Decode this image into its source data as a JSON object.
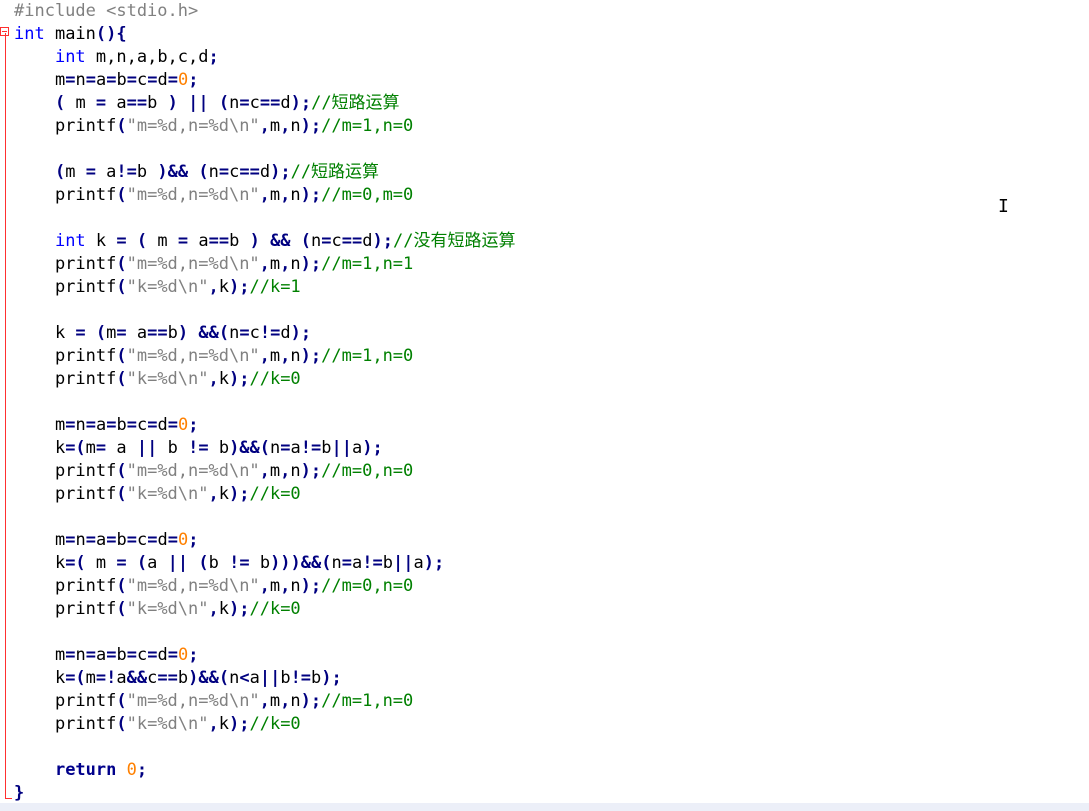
{
  "editor": {
    "language": "c",
    "colors": {
      "preprocessor": "#808080",
      "type_keyword": "#0000ff",
      "instruction_keyword": "#00008b",
      "operator": "#000080",
      "number": "#ff8000",
      "string": "#808080",
      "comment": "#008000",
      "fold_marker": "#ff3030"
    },
    "cursor_icon": "text-ibeam-cursor",
    "lines": [
      [
        {
          "t": "pp",
          "v": "#include <stdio.h>"
        }
      ],
      [
        {
          "t": "kw",
          "v": "int"
        },
        {
          "t": "id",
          "v": " main"
        },
        {
          "t": "op",
          "v": "(){"
        }
      ],
      [
        {
          "t": "id",
          "v": "    "
        },
        {
          "t": "kw",
          "v": "int"
        },
        {
          "t": "id",
          "v": " m,n,a,b,c,d"
        },
        {
          "t": "op",
          "v": ";"
        }
      ],
      [
        {
          "t": "id",
          "v": "    m"
        },
        {
          "t": "op",
          "v": "="
        },
        {
          "t": "id",
          "v": "n"
        },
        {
          "t": "op",
          "v": "="
        },
        {
          "t": "id",
          "v": "a"
        },
        {
          "t": "op",
          "v": "="
        },
        {
          "t": "id",
          "v": "b"
        },
        {
          "t": "op",
          "v": "="
        },
        {
          "t": "id",
          "v": "c"
        },
        {
          "t": "op",
          "v": "="
        },
        {
          "t": "id",
          "v": "d"
        },
        {
          "t": "op",
          "v": "="
        },
        {
          "t": "num",
          "v": "0"
        },
        {
          "t": "op",
          "v": ";"
        }
      ],
      [
        {
          "t": "id",
          "v": "    "
        },
        {
          "t": "op",
          "v": "("
        },
        {
          "t": "id",
          "v": " m "
        },
        {
          "t": "op",
          "v": "="
        },
        {
          "t": "id",
          "v": " a"
        },
        {
          "t": "op",
          "v": "=="
        },
        {
          "t": "id",
          "v": "b "
        },
        {
          "t": "op",
          "v": ")"
        },
        {
          "t": "id",
          "v": " "
        },
        {
          "t": "op",
          "v": "||"
        },
        {
          "t": "id",
          "v": " "
        },
        {
          "t": "op",
          "v": "("
        },
        {
          "t": "id",
          "v": "n"
        },
        {
          "t": "op",
          "v": "="
        },
        {
          "t": "id",
          "v": "c"
        },
        {
          "t": "op",
          "v": "=="
        },
        {
          "t": "id",
          "v": "d"
        },
        {
          "t": "op",
          "v": ");"
        },
        {
          "t": "cm",
          "v": "//短路运算"
        }
      ],
      [
        {
          "t": "id",
          "v": "    printf"
        },
        {
          "t": "op",
          "v": "("
        },
        {
          "t": "str",
          "v": "\"m=%d,n=%d\\n\""
        },
        {
          "t": "op",
          "v": ","
        },
        {
          "t": "id",
          "v": "m"
        },
        {
          "t": "op",
          "v": ","
        },
        {
          "t": "id",
          "v": "n"
        },
        {
          "t": "op",
          "v": ");"
        },
        {
          "t": "cm",
          "v": "//m=1,n=0"
        }
      ],
      [],
      [
        {
          "t": "id",
          "v": "    "
        },
        {
          "t": "op",
          "v": "("
        },
        {
          "t": "id",
          "v": "m "
        },
        {
          "t": "op",
          "v": "="
        },
        {
          "t": "id",
          "v": " a"
        },
        {
          "t": "op",
          "v": "!="
        },
        {
          "t": "id",
          "v": "b "
        },
        {
          "t": "op",
          "v": ")&&"
        },
        {
          "t": "id",
          "v": " "
        },
        {
          "t": "op",
          "v": "("
        },
        {
          "t": "id",
          "v": "n"
        },
        {
          "t": "op",
          "v": "="
        },
        {
          "t": "id",
          "v": "c"
        },
        {
          "t": "op",
          "v": "=="
        },
        {
          "t": "id",
          "v": "d"
        },
        {
          "t": "op",
          "v": ");"
        },
        {
          "t": "cm",
          "v": "//短路运算"
        }
      ],
      [
        {
          "t": "id",
          "v": "    printf"
        },
        {
          "t": "op",
          "v": "("
        },
        {
          "t": "str",
          "v": "\"m=%d,n=%d\\n\""
        },
        {
          "t": "op",
          "v": ","
        },
        {
          "t": "id",
          "v": "m"
        },
        {
          "t": "op",
          "v": ","
        },
        {
          "t": "id",
          "v": "n"
        },
        {
          "t": "op",
          "v": ");"
        },
        {
          "t": "cm",
          "v": "//m=0,m=0"
        }
      ],
      [],
      [
        {
          "t": "id",
          "v": "    "
        },
        {
          "t": "kw",
          "v": "int"
        },
        {
          "t": "id",
          "v": " k "
        },
        {
          "t": "op",
          "v": "="
        },
        {
          "t": "id",
          "v": " "
        },
        {
          "t": "op",
          "v": "("
        },
        {
          "t": "id",
          "v": " m "
        },
        {
          "t": "op",
          "v": "="
        },
        {
          "t": "id",
          "v": " a"
        },
        {
          "t": "op",
          "v": "=="
        },
        {
          "t": "id",
          "v": "b "
        },
        {
          "t": "op",
          "v": ")"
        },
        {
          "t": "id",
          "v": " "
        },
        {
          "t": "op",
          "v": "&&"
        },
        {
          "t": "id",
          "v": " "
        },
        {
          "t": "op",
          "v": "("
        },
        {
          "t": "id",
          "v": "n"
        },
        {
          "t": "op",
          "v": "="
        },
        {
          "t": "id",
          "v": "c"
        },
        {
          "t": "op",
          "v": "=="
        },
        {
          "t": "id",
          "v": "d"
        },
        {
          "t": "op",
          "v": ");"
        },
        {
          "t": "cm",
          "v": "//没有短路运算"
        }
      ],
      [
        {
          "t": "id",
          "v": "    printf"
        },
        {
          "t": "op",
          "v": "("
        },
        {
          "t": "str",
          "v": "\"m=%d,n=%d\\n\""
        },
        {
          "t": "op",
          "v": ","
        },
        {
          "t": "id",
          "v": "m"
        },
        {
          "t": "op",
          "v": ","
        },
        {
          "t": "id",
          "v": "n"
        },
        {
          "t": "op",
          "v": ");"
        },
        {
          "t": "cm",
          "v": "//m=1,n=1"
        }
      ],
      [
        {
          "t": "id",
          "v": "    printf"
        },
        {
          "t": "op",
          "v": "("
        },
        {
          "t": "str",
          "v": "\"k=%d\\n\""
        },
        {
          "t": "op",
          "v": ","
        },
        {
          "t": "id",
          "v": "k"
        },
        {
          "t": "op",
          "v": ");"
        },
        {
          "t": "cm",
          "v": "//k=1"
        }
      ],
      [],
      [
        {
          "t": "id",
          "v": "    k "
        },
        {
          "t": "op",
          "v": "="
        },
        {
          "t": "id",
          "v": " "
        },
        {
          "t": "op",
          "v": "("
        },
        {
          "t": "id",
          "v": "m"
        },
        {
          "t": "op",
          "v": "="
        },
        {
          "t": "id",
          "v": " a"
        },
        {
          "t": "op",
          "v": "=="
        },
        {
          "t": "id",
          "v": "b"
        },
        {
          "t": "op",
          "v": ")"
        },
        {
          "t": "id",
          "v": " "
        },
        {
          "t": "op",
          "v": "&&("
        },
        {
          "t": "id",
          "v": "n"
        },
        {
          "t": "op",
          "v": "="
        },
        {
          "t": "id",
          "v": "c"
        },
        {
          "t": "op",
          "v": "!="
        },
        {
          "t": "id",
          "v": "d"
        },
        {
          "t": "op",
          "v": ");"
        }
      ],
      [
        {
          "t": "id",
          "v": "    printf"
        },
        {
          "t": "op",
          "v": "("
        },
        {
          "t": "str",
          "v": "\"m=%d,n=%d\\n\""
        },
        {
          "t": "op",
          "v": ","
        },
        {
          "t": "id",
          "v": "m"
        },
        {
          "t": "op",
          "v": ","
        },
        {
          "t": "id",
          "v": "n"
        },
        {
          "t": "op",
          "v": ");"
        },
        {
          "t": "cm",
          "v": "//m=1,n=0"
        }
      ],
      [
        {
          "t": "id",
          "v": "    printf"
        },
        {
          "t": "op",
          "v": "("
        },
        {
          "t": "str",
          "v": "\"k=%d\\n\""
        },
        {
          "t": "op",
          "v": ","
        },
        {
          "t": "id",
          "v": "k"
        },
        {
          "t": "op",
          "v": ");"
        },
        {
          "t": "cm",
          "v": "//k=0"
        }
      ],
      [],
      [
        {
          "t": "id",
          "v": "    m"
        },
        {
          "t": "op",
          "v": "="
        },
        {
          "t": "id",
          "v": "n"
        },
        {
          "t": "op",
          "v": "="
        },
        {
          "t": "id",
          "v": "a"
        },
        {
          "t": "op",
          "v": "="
        },
        {
          "t": "id",
          "v": "b"
        },
        {
          "t": "op",
          "v": "="
        },
        {
          "t": "id",
          "v": "c"
        },
        {
          "t": "op",
          "v": "="
        },
        {
          "t": "id",
          "v": "d"
        },
        {
          "t": "op",
          "v": "="
        },
        {
          "t": "num",
          "v": "0"
        },
        {
          "t": "op",
          "v": ";"
        }
      ],
      [
        {
          "t": "id",
          "v": "    k"
        },
        {
          "t": "op",
          "v": "=("
        },
        {
          "t": "id",
          "v": "m"
        },
        {
          "t": "op",
          "v": "="
        },
        {
          "t": "id",
          "v": " a "
        },
        {
          "t": "op",
          "v": "||"
        },
        {
          "t": "id",
          "v": " b "
        },
        {
          "t": "op",
          "v": "!="
        },
        {
          "t": "id",
          "v": " b"
        },
        {
          "t": "op",
          "v": ")&&("
        },
        {
          "t": "id",
          "v": "n"
        },
        {
          "t": "op",
          "v": "="
        },
        {
          "t": "id",
          "v": "a"
        },
        {
          "t": "op",
          "v": "!="
        },
        {
          "t": "id",
          "v": "b"
        },
        {
          "t": "op",
          "v": "||"
        },
        {
          "t": "id",
          "v": "a"
        },
        {
          "t": "op",
          "v": ");"
        }
      ],
      [
        {
          "t": "id",
          "v": "    printf"
        },
        {
          "t": "op",
          "v": "("
        },
        {
          "t": "str",
          "v": "\"m=%d,n=%d\\n\""
        },
        {
          "t": "op",
          "v": ","
        },
        {
          "t": "id",
          "v": "m"
        },
        {
          "t": "op",
          "v": ","
        },
        {
          "t": "id",
          "v": "n"
        },
        {
          "t": "op",
          "v": ");"
        },
        {
          "t": "cm",
          "v": "//m=0,n=0"
        }
      ],
      [
        {
          "t": "id",
          "v": "    printf"
        },
        {
          "t": "op",
          "v": "("
        },
        {
          "t": "str",
          "v": "\"k=%d\\n\""
        },
        {
          "t": "op",
          "v": ","
        },
        {
          "t": "id",
          "v": "k"
        },
        {
          "t": "op",
          "v": ");"
        },
        {
          "t": "cm",
          "v": "//k=0"
        }
      ],
      [],
      [
        {
          "t": "id",
          "v": "    m"
        },
        {
          "t": "op",
          "v": "="
        },
        {
          "t": "id",
          "v": "n"
        },
        {
          "t": "op",
          "v": "="
        },
        {
          "t": "id",
          "v": "a"
        },
        {
          "t": "op",
          "v": "="
        },
        {
          "t": "id",
          "v": "b"
        },
        {
          "t": "op",
          "v": "="
        },
        {
          "t": "id",
          "v": "c"
        },
        {
          "t": "op",
          "v": "="
        },
        {
          "t": "id",
          "v": "d"
        },
        {
          "t": "op",
          "v": "="
        },
        {
          "t": "num",
          "v": "0"
        },
        {
          "t": "op",
          "v": ";"
        }
      ],
      [
        {
          "t": "id",
          "v": "    k"
        },
        {
          "t": "op",
          "v": "=("
        },
        {
          "t": "id",
          "v": " m "
        },
        {
          "t": "op",
          "v": "="
        },
        {
          "t": "id",
          "v": " "
        },
        {
          "t": "op",
          "v": "("
        },
        {
          "t": "id",
          "v": "a "
        },
        {
          "t": "op",
          "v": "||"
        },
        {
          "t": "id",
          "v": " "
        },
        {
          "t": "op",
          "v": "("
        },
        {
          "t": "id",
          "v": "b "
        },
        {
          "t": "op",
          "v": "!="
        },
        {
          "t": "id",
          "v": " b"
        },
        {
          "t": "op",
          "v": ")))&&("
        },
        {
          "t": "id",
          "v": "n"
        },
        {
          "t": "op",
          "v": "="
        },
        {
          "t": "id",
          "v": "a"
        },
        {
          "t": "op",
          "v": "!="
        },
        {
          "t": "id",
          "v": "b"
        },
        {
          "t": "op",
          "v": "||"
        },
        {
          "t": "id",
          "v": "a"
        },
        {
          "t": "op",
          "v": ");"
        }
      ],
      [
        {
          "t": "id",
          "v": "    printf"
        },
        {
          "t": "op",
          "v": "("
        },
        {
          "t": "str",
          "v": "\"m=%d,n=%d\\n\""
        },
        {
          "t": "op",
          "v": ","
        },
        {
          "t": "id",
          "v": "m"
        },
        {
          "t": "op",
          "v": ","
        },
        {
          "t": "id",
          "v": "n"
        },
        {
          "t": "op",
          "v": ");"
        },
        {
          "t": "cm",
          "v": "//m=0,n=0"
        }
      ],
      [
        {
          "t": "id",
          "v": "    printf"
        },
        {
          "t": "op",
          "v": "("
        },
        {
          "t": "str",
          "v": "\"k=%d\\n\""
        },
        {
          "t": "op",
          "v": ","
        },
        {
          "t": "id",
          "v": "k"
        },
        {
          "t": "op",
          "v": ");"
        },
        {
          "t": "cm",
          "v": "//k=0"
        }
      ],
      [],
      [
        {
          "t": "id",
          "v": "    m"
        },
        {
          "t": "op",
          "v": "="
        },
        {
          "t": "id",
          "v": "n"
        },
        {
          "t": "op",
          "v": "="
        },
        {
          "t": "id",
          "v": "a"
        },
        {
          "t": "op",
          "v": "="
        },
        {
          "t": "id",
          "v": "b"
        },
        {
          "t": "op",
          "v": "="
        },
        {
          "t": "id",
          "v": "c"
        },
        {
          "t": "op",
          "v": "="
        },
        {
          "t": "id",
          "v": "d"
        },
        {
          "t": "op",
          "v": "="
        },
        {
          "t": "num",
          "v": "0"
        },
        {
          "t": "op",
          "v": ";"
        }
      ],
      [
        {
          "t": "id",
          "v": "    k"
        },
        {
          "t": "op",
          "v": "=("
        },
        {
          "t": "id",
          "v": "m"
        },
        {
          "t": "op",
          "v": "=!"
        },
        {
          "t": "id",
          "v": "a"
        },
        {
          "t": "op",
          "v": "&&"
        },
        {
          "t": "id",
          "v": "c"
        },
        {
          "t": "op",
          "v": "=="
        },
        {
          "t": "id",
          "v": "b"
        },
        {
          "t": "op",
          "v": ")&&("
        },
        {
          "t": "id",
          "v": "n"
        },
        {
          "t": "op",
          "v": "<"
        },
        {
          "t": "id",
          "v": "a"
        },
        {
          "t": "op",
          "v": "||"
        },
        {
          "t": "id",
          "v": "b"
        },
        {
          "t": "op",
          "v": "!="
        },
        {
          "t": "id",
          "v": "b"
        },
        {
          "t": "op",
          "v": ");"
        }
      ],
      [
        {
          "t": "id",
          "v": "    printf"
        },
        {
          "t": "op",
          "v": "("
        },
        {
          "t": "str",
          "v": "\"m=%d,n=%d\\n\""
        },
        {
          "t": "op",
          "v": ","
        },
        {
          "t": "id",
          "v": "m"
        },
        {
          "t": "op",
          "v": ","
        },
        {
          "t": "id",
          "v": "n"
        },
        {
          "t": "op",
          "v": ");"
        },
        {
          "t": "cm",
          "v": "//m=1,n=0"
        }
      ],
      [
        {
          "t": "id",
          "v": "    printf"
        },
        {
          "t": "op",
          "v": "("
        },
        {
          "t": "str",
          "v": "\"k=%d\\n\""
        },
        {
          "t": "op",
          "v": ","
        },
        {
          "t": "id",
          "v": "k"
        },
        {
          "t": "op",
          "v": ");"
        },
        {
          "t": "cm",
          "v": "//k=0"
        }
      ],
      [],
      [
        {
          "t": "id",
          "v": "    "
        },
        {
          "t": "kwb",
          "v": "return"
        },
        {
          "t": "id",
          "v": " "
        },
        {
          "t": "num",
          "v": "0"
        },
        {
          "t": "op",
          "v": ";"
        }
      ],
      [
        {
          "t": "op",
          "v": "}"
        }
      ]
    ]
  }
}
